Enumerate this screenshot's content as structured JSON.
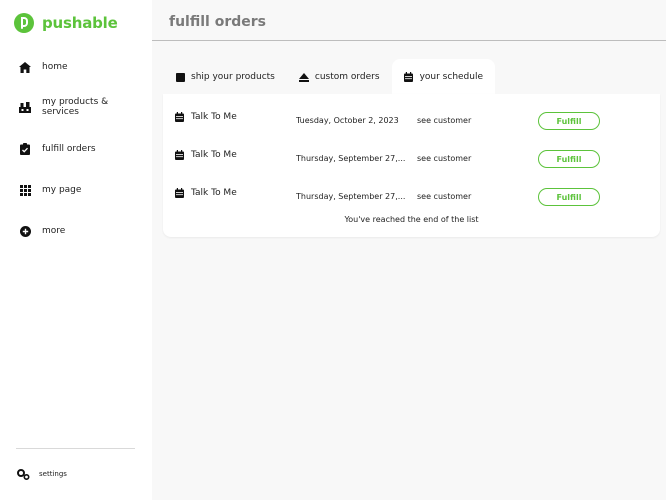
{
  "brand": {
    "name": "pushable",
    "color": "#5cc33b"
  },
  "sidebar": {
    "items": [
      {
        "label": "home",
        "icon": "home-icon"
      },
      {
        "label": "my products & services",
        "icon": "products-icon"
      },
      {
        "label": "fulfill orders",
        "icon": "clipboard-icon"
      },
      {
        "label": "my page",
        "icon": "grid-icon"
      },
      {
        "label": "more",
        "icon": "plus-circle-icon"
      }
    ],
    "settings_label": "settings"
  },
  "header": {
    "title": "fulfill orders"
  },
  "tabs": [
    {
      "label": "ship your products",
      "icon": "box-icon",
      "active": false
    },
    {
      "label": "custom orders",
      "icon": "eject-icon",
      "active": false
    },
    {
      "label": "your schedule",
      "icon": "calendar-icon",
      "active": true
    }
  ],
  "schedule": {
    "rows": [
      {
        "name": "Talk To Me",
        "date": "Tuesday, October 2, 2023",
        "link": "see customer",
        "action": "Fulfill"
      },
      {
        "name": "Talk To Me",
        "date": "Thursday, September 27,...",
        "link": "see customer",
        "action": "Fulfill"
      },
      {
        "name": "Talk To Me",
        "date": "Thursday, September 27,...",
        "link": "see customer",
        "action": "Fulfill"
      }
    ],
    "end_message": "You've reached the end of the list"
  }
}
